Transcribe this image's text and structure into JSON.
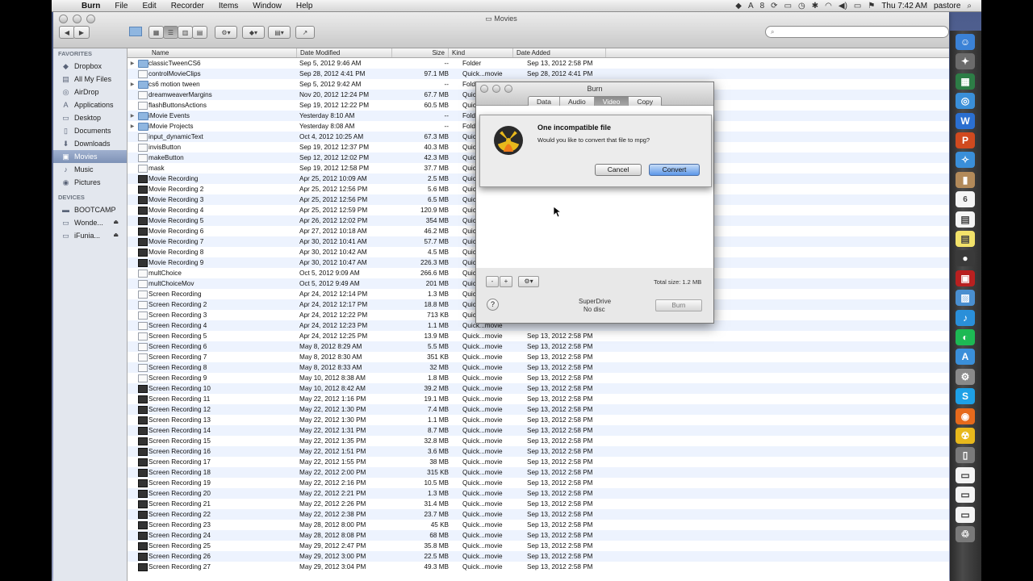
{
  "menubar": {
    "app": "Burn",
    "items": [
      "File",
      "Edit",
      "Recorder",
      "Items",
      "Window",
      "Help"
    ],
    "status": [
      "8",
      "Thu 7:42 AM",
      "pastore"
    ]
  },
  "finder": {
    "title": "Movies",
    "search_placeholder": "",
    "sidebar": {
      "favorites_header": "FAVORITES",
      "favorites": [
        {
          "label": "Dropbox",
          "icon": "dropbox-icon"
        },
        {
          "label": "All My Files",
          "icon": "files-icon"
        },
        {
          "label": "AirDrop",
          "icon": "airdrop-icon"
        },
        {
          "label": "Applications",
          "icon": "applications-icon"
        },
        {
          "label": "Desktop",
          "icon": "desktop-icon"
        },
        {
          "label": "Documents",
          "icon": "documents-icon"
        },
        {
          "label": "Downloads",
          "icon": "downloads-icon"
        },
        {
          "label": "Movies",
          "icon": "movies-icon"
        },
        {
          "label": "Music",
          "icon": "music-icon"
        },
        {
          "label": "Pictures",
          "icon": "pictures-icon"
        }
      ],
      "devices_header": "DEVICES",
      "devices": [
        {
          "label": "BOOTCAMP"
        },
        {
          "label": "Wonde..."
        },
        {
          "label": "iFunia..."
        }
      ]
    },
    "columns": {
      "name": "Name",
      "date": "Date Modified",
      "size": "Size",
      "kind": "Kind",
      "added": "Date Added"
    },
    "rows": [
      {
        "name": "classicTweenCS6",
        "date": "Sep 5, 2012 9:46 AM",
        "size": "--",
        "kind": "Folder",
        "added": "Sep 13, 2012 2:58 PM",
        "type": "folder",
        "exp": true
      },
      {
        "name": "controlMovieClips",
        "date": "Sep 28, 2012 4:41 PM",
        "size": "97.1 MB",
        "kind": "Quick...movie",
        "added": "Sep 28, 2012 4:41 PM",
        "type": "doc",
        "exp": false
      },
      {
        "name": "cs6 motion tween",
        "date": "Sep 5, 2012 9:42 AM",
        "size": "--",
        "kind": "Folder",
        "added": "Sep 13, 2012 2:58 PM",
        "type": "folder",
        "exp": true
      },
      {
        "name": "dreamweaverMargins",
        "date": "Nov 20, 2012 12:24 PM",
        "size": "67.7 MB",
        "kind": "Quick...movie",
        "added": "",
        "type": "doc",
        "exp": false
      },
      {
        "name": "flashButtonsActions",
        "date": "Sep 19, 2012 12:22 PM",
        "size": "60.5 MB",
        "kind": "Quick...movie",
        "added": "",
        "type": "doc",
        "exp": false
      },
      {
        "name": "iMovie Events",
        "date": "Yesterday 8:10 AM",
        "size": "--",
        "kind": "Folder",
        "added": "",
        "type": "folder",
        "exp": true
      },
      {
        "name": "iMovie Projects",
        "date": "Yesterday 8:08 AM",
        "size": "--",
        "kind": "Folder",
        "added": "",
        "type": "folder",
        "exp": true
      },
      {
        "name": "input_dynamicText",
        "date": "Oct 4, 2012 10:25 AM",
        "size": "67.3 MB",
        "kind": "Quick...movie",
        "added": "",
        "type": "doc",
        "exp": false
      },
      {
        "name": "invisButton",
        "date": "Sep 19, 2012 12:37 PM",
        "size": "40.3 MB",
        "kind": "Quick...movie",
        "added": "",
        "type": "doc",
        "exp": false
      },
      {
        "name": "makeButton",
        "date": "Sep 12, 2012 12:02 PM",
        "size": "42.3 MB",
        "kind": "Quick...movie",
        "added": "",
        "type": "doc",
        "exp": false
      },
      {
        "name": "mask",
        "date": "Sep 19, 2012 12:58 PM",
        "size": "37.7 MB",
        "kind": "Quick...movie",
        "added": "",
        "type": "doc",
        "exp": false
      },
      {
        "name": "Movie Recording",
        "date": "Apr 25, 2012 10:09 AM",
        "size": "2.5 MB",
        "kind": "Quick...movie",
        "added": "",
        "type": "mov",
        "exp": false
      },
      {
        "name": "Movie Recording 2",
        "date": "Apr 25, 2012 12:56 PM",
        "size": "5.6 MB",
        "kind": "Quick...movie",
        "added": "",
        "type": "mov",
        "exp": false
      },
      {
        "name": "Movie Recording 3",
        "date": "Apr 25, 2012 12:56 PM",
        "size": "6.5 MB",
        "kind": "Quick...movie",
        "added": "",
        "type": "mov",
        "exp": false
      },
      {
        "name": "Movie Recording 4",
        "date": "Apr 25, 2012 12:59 PM",
        "size": "120.9 MB",
        "kind": "Quick...movie",
        "added": "",
        "type": "mov",
        "exp": false
      },
      {
        "name": "Movie Recording 5",
        "date": "Apr 26, 2012 12:02 PM",
        "size": "354 MB",
        "kind": "Quick...movie",
        "added": "",
        "type": "mov",
        "exp": false
      },
      {
        "name": "Movie Recording 6",
        "date": "Apr 27, 2012 10:18 AM",
        "size": "46.2 MB",
        "kind": "Quick...movie",
        "added": "",
        "type": "mov",
        "exp": false
      },
      {
        "name": "Movie Recording 7",
        "date": "Apr 30, 2012 10:41 AM",
        "size": "57.7 MB",
        "kind": "Quick...movie",
        "added": "",
        "type": "mov",
        "exp": false
      },
      {
        "name": "Movie Recording 8",
        "date": "Apr 30, 2012 10:42 AM",
        "size": "4.5 MB",
        "kind": "Quick...movie",
        "added": "",
        "type": "mov",
        "exp": false
      },
      {
        "name": "Movie Recording 9",
        "date": "Apr 30, 2012 10:47 AM",
        "size": "226.3 MB",
        "kind": "Quick...movie",
        "added": "",
        "type": "mov",
        "exp": false
      },
      {
        "name": "multChoice",
        "date": "Oct 5, 2012 9:09 AM",
        "size": "266.6 MB",
        "kind": "Quick...movie",
        "added": "",
        "type": "doc",
        "exp": false
      },
      {
        "name": "multChoiceMov",
        "date": "Oct 5, 2012 9:49 AM",
        "size": "201 MB",
        "kind": "Quick...movie",
        "added": "",
        "type": "doc",
        "exp": false
      },
      {
        "name": "Screen Recording",
        "date": "Apr 24, 2012 12:14 PM",
        "size": "1.3 MB",
        "kind": "Quick...movie",
        "added": "",
        "type": "doc",
        "exp": false
      },
      {
        "name": "Screen Recording 2",
        "date": "Apr 24, 2012 12:17 PM",
        "size": "18.8 MB",
        "kind": "Quick...movie",
        "added": "",
        "type": "doc",
        "exp": false
      },
      {
        "name": "Screen Recording 3",
        "date": "Apr 24, 2012 12:22 PM",
        "size": "713 KB",
        "kind": "Quick...movie",
        "added": "",
        "type": "doc",
        "exp": false
      },
      {
        "name": "Screen Recording 4",
        "date": "Apr 24, 2012 12:23 PM",
        "size": "1.1 MB",
        "kind": "Quick...movie",
        "added": "",
        "type": "doc",
        "exp": false
      },
      {
        "name": "Screen Recording 5",
        "date": "Apr 24, 2012 12:25 PM",
        "size": "13.9 MB",
        "kind": "Quick...movie",
        "added": "Sep 13, 2012 2:58 PM",
        "type": "doc",
        "exp": false
      },
      {
        "name": "Screen Recording 6",
        "date": "May 8, 2012 8:29 AM",
        "size": "5.5 MB",
        "kind": "Quick...movie",
        "added": "Sep 13, 2012 2:58 PM",
        "type": "doc",
        "exp": false
      },
      {
        "name": "Screen Recording 7",
        "date": "May 8, 2012 8:30 AM",
        "size": "351 KB",
        "kind": "Quick...movie",
        "added": "Sep 13, 2012 2:58 PM",
        "type": "doc",
        "exp": false
      },
      {
        "name": "Screen Recording 8",
        "date": "May 8, 2012 8:33 AM",
        "size": "32 MB",
        "kind": "Quick...movie",
        "added": "Sep 13, 2012 2:58 PM",
        "type": "doc",
        "exp": false
      },
      {
        "name": "Screen Recording 9",
        "date": "May 10, 2012 8:38 AM",
        "size": "1.8 MB",
        "kind": "Quick...movie",
        "added": "Sep 13, 2012 2:58 PM",
        "type": "doc",
        "exp": false
      },
      {
        "name": "Screen Recording 10",
        "date": "May 10, 2012 8:42 AM",
        "size": "39.2 MB",
        "kind": "Quick...movie",
        "added": "Sep 13, 2012 2:58 PM",
        "type": "mov",
        "exp": false
      },
      {
        "name": "Screen Recording 11",
        "date": "May 22, 2012 1:16 PM",
        "size": "19.1 MB",
        "kind": "Quick...movie",
        "added": "Sep 13, 2012 2:58 PM",
        "type": "mov",
        "exp": false
      },
      {
        "name": "Screen Recording 12",
        "date": "May 22, 2012 1:30 PM",
        "size": "7.4 MB",
        "kind": "Quick...movie",
        "added": "Sep 13, 2012 2:58 PM",
        "type": "mov",
        "exp": false
      },
      {
        "name": "Screen Recording 13",
        "date": "May 22, 2012 1:30 PM",
        "size": "1.1 MB",
        "kind": "Quick...movie",
        "added": "Sep 13, 2012 2:58 PM",
        "type": "mov",
        "exp": false
      },
      {
        "name": "Screen Recording 14",
        "date": "May 22, 2012 1:31 PM",
        "size": "8.7 MB",
        "kind": "Quick...movie",
        "added": "Sep 13, 2012 2:58 PM",
        "type": "mov",
        "exp": false
      },
      {
        "name": "Screen Recording 15",
        "date": "May 22, 2012 1:35 PM",
        "size": "32.8 MB",
        "kind": "Quick...movie",
        "added": "Sep 13, 2012 2:58 PM",
        "type": "mov",
        "exp": false
      },
      {
        "name": "Screen Recording 16",
        "date": "May 22, 2012 1:51 PM",
        "size": "3.6 MB",
        "kind": "Quick...movie",
        "added": "Sep 13, 2012 2:58 PM",
        "type": "mov",
        "exp": false
      },
      {
        "name": "Screen Recording 17",
        "date": "May 22, 2012 1:55 PM",
        "size": "38 MB",
        "kind": "Quick...movie",
        "added": "Sep 13, 2012 2:58 PM",
        "type": "mov",
        "exp": false
      },
      {
        "name": "Screen Recording 18",
        "date": "May 22, 2012 2:00 PM",
        "size": "315 KB",
        "kind": "Quick...movie",
        "added": "Sep 13, 2012 2:58 PM",
        "type": "mov",
        "exp": false
      },
      {
        "name": "Screen Recording 19",
        "date": "May 22, 2012 2:16 PM",
        "size": "10.5 MB",
        "kind": "Quick...movie",
        "added": "Sep 13, 2012 2:58 PM",
        "type": "mov",
        "exp": false
      },
      {
        "name": "Screen Recording 20",
        "date": "May 22, 2012 2:21 PM",
        "size": "1.3 MB",
        "kind": "Quick...movie",
        "added": "Sep 13, 2012 2:58 PM",
        "type": "mov",
        "exp": false
      },
      {
        "name": "Screen Recording 21",
        "date": "May 22, 2012 2:26 PM",
        "size": "31.4 MB",
        "kind": "Quick...movie",
        "added": "Sep 13, 2012 2:58 PM",
        "type": "mov",
        "exp": false
      },
      {
        "name": "Screen Recording 22",
        "date": "May 22, 2012 2:38 PM",
        "size": "23.7 MB",
        "kind": "Quick...movie",
        "added": "Sep 13, 2012 2:58 PM",
        "type": "mov",
        "exp": false
      },
      {
        "name": "Screen Recording 23",
        "date": "May 28, 2012 8:00 PM",
        "size": "45 KB",
        "kind": "Quick...movie",
        "added": "Sep 13, 2012 2:58 PM",
        "type": "mov",
        "exp": false
      },
      {
        "name": "Screen Recording 24",
        "date": "May 28, 2012 8:08 PM",
        "size": "68 MB",
        "kind": "Quick...movie",
        "added": "Sep 13, 2012 2:58 PM",
        "type": "mov",
        "exp": false
      },
      {
        "name": "Screen Recording 25",
        "date": "May 29, 2012 2:47 PM",
        "size": "35.8 MB",
        "kind": "Quick...movie",
        "added": "Sep 13, 2012 2:58 PM",
        "type": "mov",
        "exp": false
      },
      {
        "name": "Screen Recording 26",
        "date": "May 29, 2012 3:00 PM",
        "size": "22.5 MB",
        "kind": "Quick...movie",
        "added": "Sep 13, 2012 2:58 PM",
        "type": "mov",
        "exp": false
      },
      {
        "name": "Screen Recording 27",
        "date": "May 29, 2012 3:04 PM",
        "size": "49.3 MB",
        "kind": "Quick...movie",
        "added": "Sep 13, 2012 2:58 PM",
        "type": "mov",
        "exp": false
      }
    ]
  },
  "burn": {
    "title": "Burn",
    "tabs": [
      "Data",
      "Audio",
      "Video",
      "Copy"
    ],
    "active_tab": 2,
    "minus": "-",
    "plus": "+",
    "total_size": "Total size: 1.2 MB",
    "help": "?",
    "drive": "SuperDrive",
    "disc": "No disc",
    "burn_button": "Burn"
  },
  "alert": {
    "title": "One incompatible file",
    "message": "Would you like to convert that file to mpg?",
    "cancel": "Cancel",
    "convert": "Convert"
  },
  "dock": {
    "items": [
      "finder-icon",
      "launchpad-icon",
      "mission-control-icon",
      "safari-icon",
      "word-icon",
      "powerpoint-icon",
      "compass-icon",
      "contacts-icon",
      "calendar-icon",
      "notes-icon",
      "stickies-icon",
      "facetime-icon",
      "photobooth-icon",
      "iphoto-icon",
      "itunes-icon",
      "spotify-icon",
      "appstore-icon",
      "preferences-icon",
      "skype-icon",
      "firefox-icon",
      "burn-icon",
      "trash-util-icon",
      "window-icon",
      "window-icon",
      "window-icon",
      "trash-icon"
    ],
    "calendar_day": "6"
  }
}
